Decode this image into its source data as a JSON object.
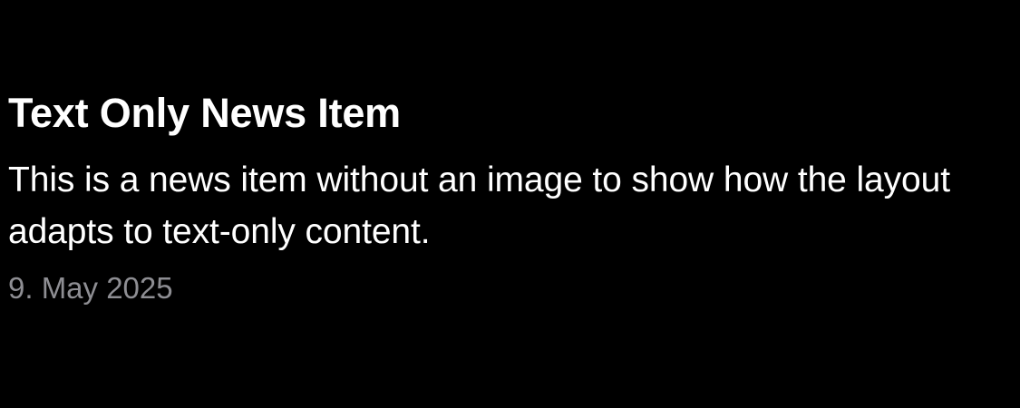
{
  "news_item": {
    "title": "Text Only News Item",
    "body": "This is a news item without an image to show how the layout adapts to text-only content.",
    "date": "9. May 2025"
  },
  "colors": {
    "background": "#000000",
    "title": "#ffffff",
    "body": "#ffffff",
    "date": "#8e8e93"
  }
}
